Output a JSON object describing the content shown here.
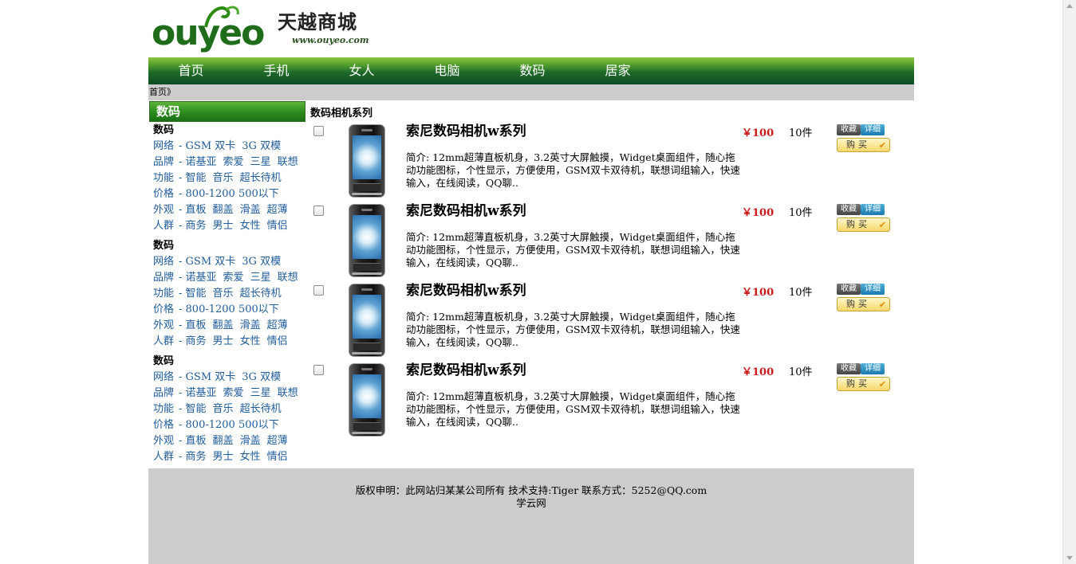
{
  "header": {
    "logo_text_main": "ouyeo",
    "logo_brand": "天越商城",
    "logo_url": "www.ouyeo.com"
  },
  "nav": {
    "items": [
      "首页",
      "手机",
      "女人",
      "电脑",
      "数码",
      "居家"
    ]
  },
  "breadcrumb": "首页》",
  "sidebar": {
    "title": "数码",
    "groups": [
      {
        "heading": "数码",
        "rows": [
          {
            "key": "网络",
            "values": [
              "- GSM 双卡",
              "3G 双模"
            ]
          },
          {
            "key": "品牌",
            "values": [
              "- 诺基亚",
              "索爱",
              "三星",
              "联想"
            ]
          },
          {
            "key": "功能",
            "values": [
              "- 智能",
              "音乐",
              "超长待机"
            ]
          },
          {
            "key": "价格",
            "values": [
              "- 800-1200 500以下"
            ]
          },
          {
            "key": "外观",
            "values": [
              "- 直板",
              "翻盖",
              "滑盖",
              "超薄"
            ]
          },
          {
            "key": "人群",
            "values": [
              "- 商务",
              "男士",
              "女性",
              "情侣"
            ]
          }
        ]
      },
      {
        "heading": "数码",
        "rows": [
          {
            "key": "网络",
            "values": [
              "- GSM 双卡",
              "3G 双模"
            ]
          },
          {
            "key": "品牌",
            "values": [
              "- 诺基亚",
              "索爱",
              "三星",
              "联想"
            ]
          },
          {
            "key": "功能",
            "values": [
              "- 智能",
              "音乐",
              "超长待机"
            ]
          },
          {
            "key": "价格",
            "values": [
              "- 800-1200 500以下"
            ]
          },
          {
            "key": "外观",
            "values": [
              "- 直板",
              "翻盖",
              "滑盖",
              "超薄"
            ]
          },
          {
            "key": "人群",
            "values": [
              "- 商务",
              "男士",
              "女性",
              "情侣"
            ]
          }
        ]
      },
      {
        "heading": "数码",
        "rows": [
          {
            "key": "网络",
            "values": [
              "- GSM 双卡",
              "3G 双模"
            ]
          },
          {
            "key": "品牌",
            "values": [
              "- 诺基亚",
              "索爱",
              "三星",
              "联想"
            ]
          },
          {
            "key": "功能",
            "values": [
              "- 智能",
              "音乐",
              "超长待机"
            ]
          },
          {
            "key": "价格",
            "values": [
              "- 800-1200 500以下"
            ]
          },
          {
            "key": "外观",
            "values": [
              "- 直板",
              "翻盖",
              "滑盖",
              "超薄"
            ]
          },
          {
            "key": "人群",
            "values": [
              "- 商务",
              "男士",
              "女性",
              "情侣"
            ]
          }
        ]
      }
    ]
  },
  "main": {
    "title": "数码相机系列",
    "products": [
      {
        "name": "索尼数码相机w系列",
        "desc": "简介: 12mm超薄直板机身，3.2英寸大屏触摸，Widget桌面组件，随心拖动功能图标，个性显示，方便使用，GSM双卡双待机，联想词组输入，快速输入，在线阅读，QQ聊..",
        "price": "￥100",
        "stock": "10件",
        "fav_label": "收藏",
        "detail_label": "详细",
        "buy_label": "购买",
        "checked": false
      },
      {
        "name": "索尼数码相机w系列",
        "desc": "简介: 12mm超薄直板机身，3.2英寸大屏触摸，Widget桌面组件，随心拖动功能图标，个性显示，方便使用，GSM双卡双待机，联想词组输入，快速输入，在线阅读，QQ聊..",
        "price": "￥100",
        "stock": "10件",
        "fav_label": "收藏",
        "detail_label": "详细",
        "buy_label": "购买",
        "checked": false
      },
      {
        "name": "索尼数码相机w系列",
        "desc": "简介: 12mm超薄直板机身，3.2英寸大屏触摸，Widget桌面组件，随心拖动功能图标，个性显示，方便使用，GSM双卡双待机，联想词组输入，快速输入，在线阅读，QQ聊..",
        "price": "￥100",
        "stock": "10件",
        "fav_label": "收藏",
        "detail_label": "详细",
        "buy_label": "购买",
        "checked": false
      },
      {
        "name": "索尼数码相机w系列",
        "desc": "简介: 12mm超薄直板机身，3.2英寸大屏触摸，Widget桌面组件，随心拖动功能图标，个性显示，方便使用，GSM双卡双待机，联想词组输入，快速输入，在线阅读，QQ聊..",
        "price": "￥100",
        "stock": "10件",
        "fav_label": "收藏",
        "detail_label": "详细",
        "buy_label": "购买",
        "checked": false
      }
    ]
  },
  "footer": {
    "copyright": "版权申明：此网站归某某公司所有  技术支持:Tiger 联系方式：5252@QQ.com",
    "sub": "学云网"
  },
  "colors": {
    "nav_green": "#1f6a2a",
    "price_red": "#cc1a1a",
    "link_blue": "#1f5c9b",
    "gray_band": "#cccccc"
  },
  "icons": {
    "phone_image": "mobile-phone-image",
    "buy_tick": "check-icon"
  }
}
